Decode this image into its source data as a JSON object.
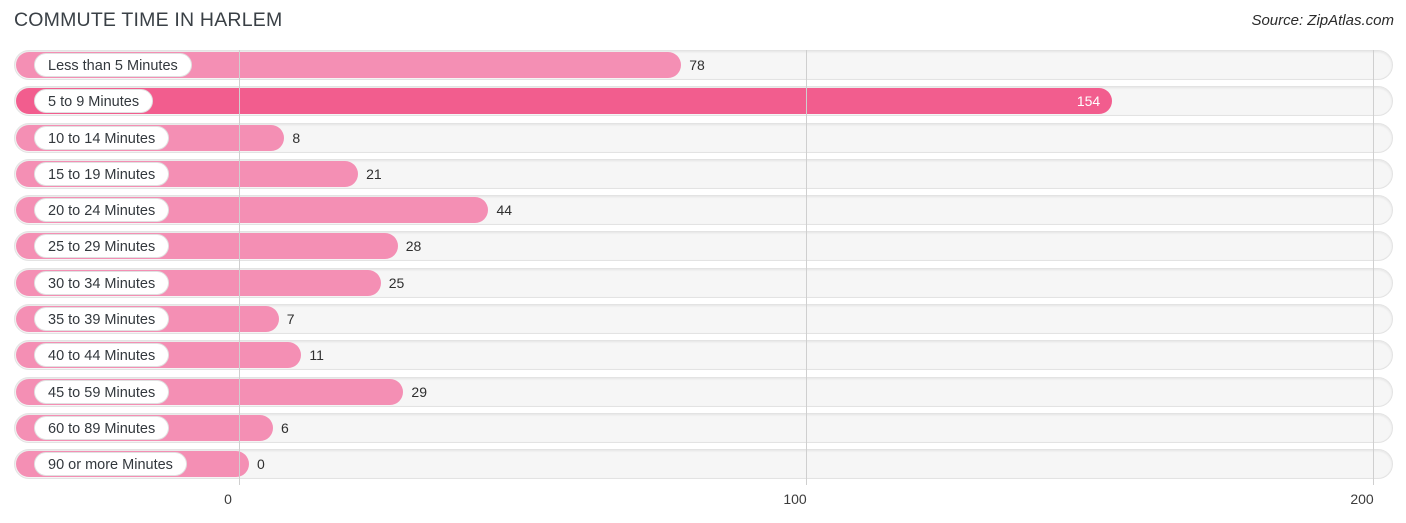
{
  "header": {
    "title": "COMMUTE TIME IN HARLEM",
    "source": "Source: ZipAtlas.com"
  },
  "colors": {
    "bar_default": "#F48FB4",
    "bar_highlight": "#F25D8E",
    "track": "#f6f6f6",
    "gridline": "#cfcfcf",
    "label_text": "#33383d",
    "value_text": "#2f2f2f",
    "value_text_inside": "#ffffff"
  },
  "chart_data": {
    "type": "bar",
    "orientation": "horizontal",
    "title": "COMMUTE TIME IN HARLEM",
    "xlabel": "",
    "ylabel": "",
    "xlim": [
      0,
      200
    ],
    "ticks": [
      "0",
      "100",
      "200"
    ],
    "tick_values": [
      0,
      100,
      200
    ],
    "grid": true,
    "legend": false,
    "categories": [
      "Less than 5 Minutes",
      "5 to 9 Minutes",
      "10 to 14 Minutes",
      "15 to 19 Minutes",
      "20 to 24 Minutes",
      "25 to 29 Minutes",
      "30 to 34 Minutes",
      "35 to 39 Minutes",
      "40 to 44 Minutes",
      "45 to 59 Minutes",
      "60 to 89 Minutes",
      "90 or more Minutes"
    ],
    "values": [
      78,
      154,
      8,
      21,
      44,
      28,
      25,
      7,
      11,
      29,
      6,
      0
    ],
    "value_labels": [
      "78",
      "154",
      "8",
      "21",
      "44",
      "28",
      "25",
      "7",
      "11",
      "29",
      "6",
      "0"
    ],
    "highlight_index": 1
  }
}
